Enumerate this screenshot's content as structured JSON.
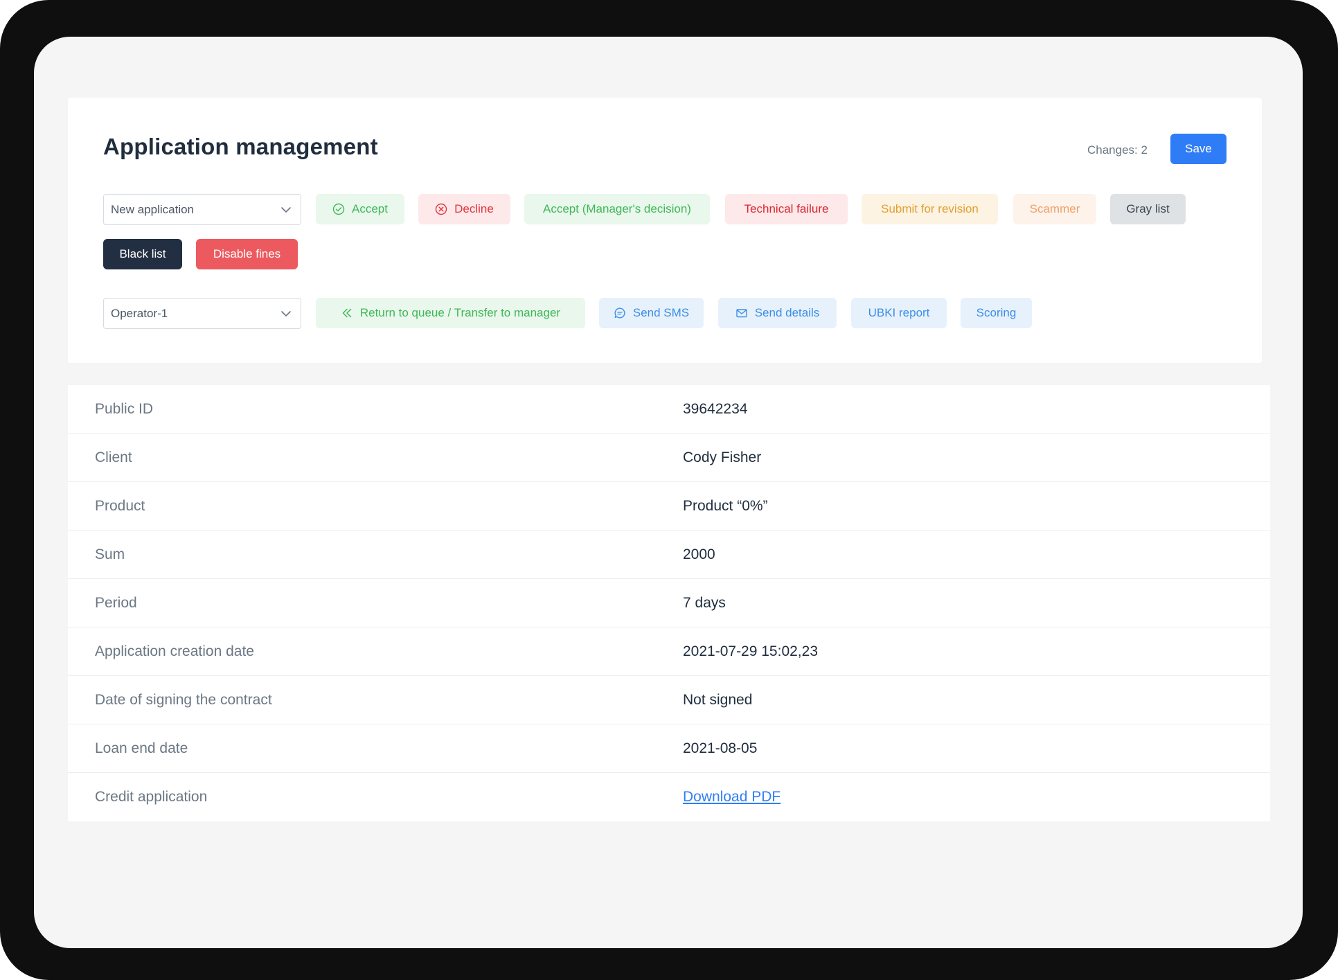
{
  "header": {
    "title": "Application management",
    "changes_text": "Changes: 2",
    "save_label": "Save"
  },
  "status_select": {
    "value": "New application"
  },
  "status_actions": {
    "accept": "Accept",
    "decline": "Decline",
    "accept_manager": "Accept (Manager's decision)",
    "technical_failure": "Technical failure",
    "submit_revision": "Submit for revision",
    "scammer": "Scammer",
    "gray_list": "Gray list",
    "black_list": "Black list",
    "disable_fines": "Disable fines"
  },
  "operator_select": {
    "value": "Operator-1"
  },
  "operator_actions": {
    "return_queue": "Return to queue / Transfer to manager",
    "send_sms": "Send SMS",
    "send_details": "Send details",
    "ubki_report": "UBKI report",
    "scoring": "Scoring"
  },
  "details": {
    "public_id": {
      "label": "Public ID",
      "value": "39642234"
    },
    "client": {
      "label": "Client",
      "value": "Cody Fisher"
    },
    "product": {
      "label": "Product",
      "value": "Product “0%”"
    },
    "sum": {
      "label": "Sum",
      "value": "2000"
    },
    "period": {
      "label": "Period",
      "value": "7 days"
    },
    "creation_date": {
      "label": "Application creation date",
      "value": "2021-07-29 15:02,23"
    },
    "signing_date": {
      "label": "Date of signing the contract",
      "value": "Not signed"
    },
    "loan_end": {
      "label": "Loan end date",
      "value": "2021-08-05"
    },
    "credit_application": {
      "label": "Credit application",
      "value": "Download PDF"
    }
  },
  "colors": {
    "primary": "#2f7df6",
    "success": "#3fb757",
    "danger": "#e2343c",
    "warning": "#e0a030",
    "dark": "#222f42"
  }
}
